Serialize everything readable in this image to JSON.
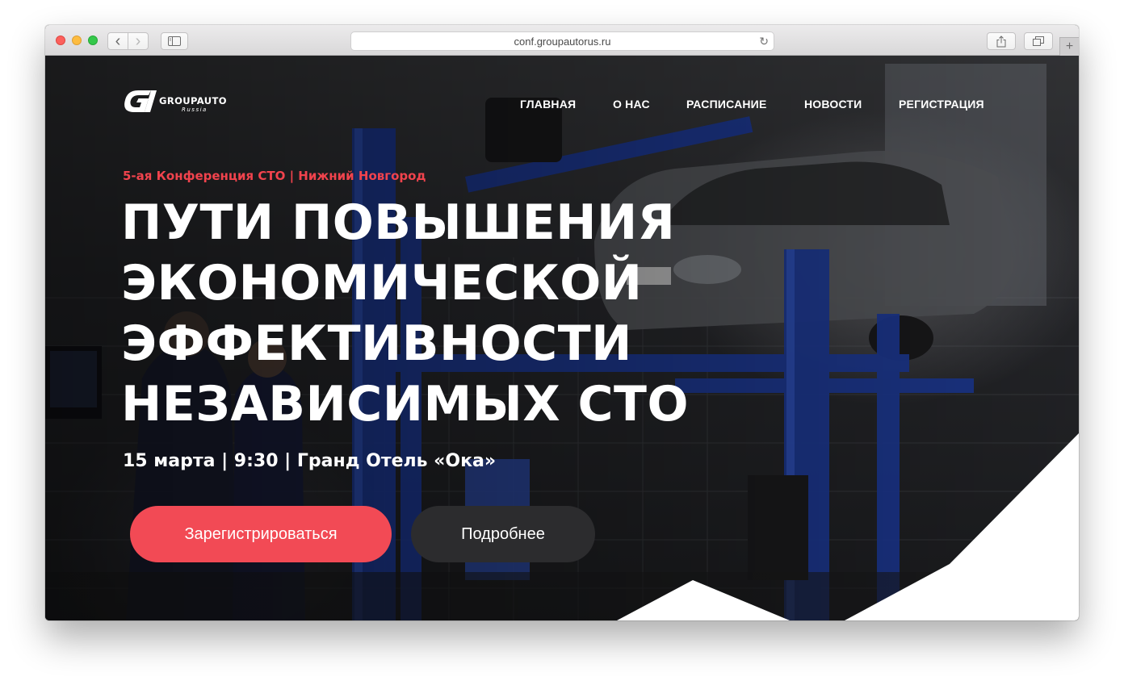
{
  "browser": {
    "url": "conf.groupautorus.ru",
    "back_icon": "‹",
    "forward_icon": "›",
    "reload_icon": "↻",
    "new_tab_icon": "+"
  },
  "logo": {
    "name": "GROUPAUTO",
    "sub": "Russia"
  },
  "nav": {
    "items": [
      "ГЛАВНАЯ",
      "О НАС",
      "РАСПИСАНИЕ",
      "НОВОСТИ",
      "РЕГИСТРАЦИЯ"
    ]
  },
  "hero": {
    "eyebrow": "5-ая Конференция СТО | Нижний Новгород",
    "headline_lines": [
      "ПУТИ ПОВЫШЕНИЯ",
      "ЭКОНОМИЧЕСКОЙ",
      "ЭФФЕКТИВНОСТИ",
      "НЕЗАВИСИМЫХ СТО"
    ],
    "event_info": "15 марта | 9:30 | Гранд Отель «Ока»",
    "register_button": "Зарегистрироваться",
    "more_button": "Подробнее"
  },
  "colors": {
    "accent": "#f24a55",
    "eyebrow": "#f1434d",
    "dark_button": "#2c2c2e",
    "lift_blue": "#1f3d9c"
  }
}
